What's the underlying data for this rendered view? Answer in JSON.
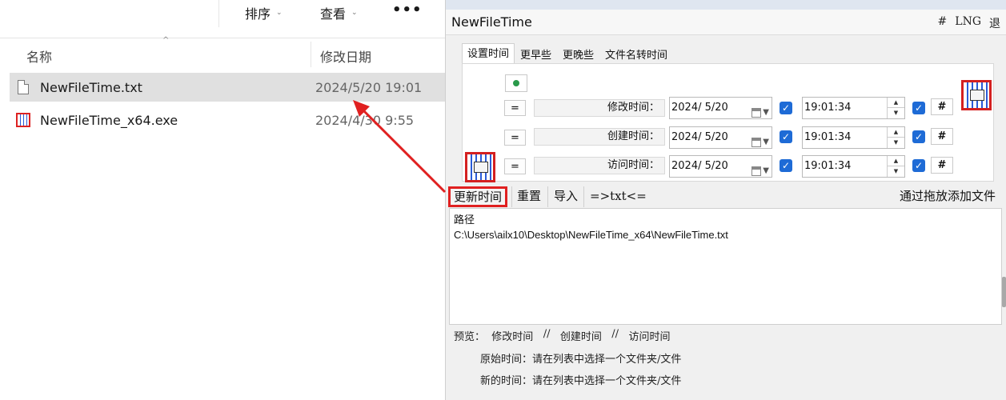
{
  "explorer": {
    "toolbar": {
      "sort_label": "排序",
      "view_label": "查看",
      "more_label": "•••"
    },
    "columns": {
      "name": "名称",
      "modified": "修改日期"
    },
    "files": [
      {
        "name": "NewFileTime.txt",
        "modified": "2024/5/20 19:01",
        "icon": "text-file-icon",
        "selected": true
      },
      {
        "name": "NewFileTime_x64.exe",
        "modified": "2024/4/30 9:55",
        "icon": "app-exe-icon",
        "selected": false
      }
    ]
  },
  "newfiletime": {
    "title": "NewFileTime",
    "title_actions": {
      "hash": "#",
      "lang": "LNG",
      "exit": "退"
    },
    "tabs": [
      "设置时间",
      "更早些",
      "更晚些",
      "文件名转时间"
    ],
    "active_tab": 0,
    "rows": [
      {
        "eq": "=",
        "label": "修改时间：",
        "date": "2024/  5/20",
        "time": "19:01:34",
        "hash": "#"
      },
      {
        "eq": "=",
        "label": "创建时间：",
        "date": "2024/  5/20",
        "time": "19:01:34",
        "hash": "#"
      },
      {
        "eq": "=",
        "label": "访问时间：",
        "date": "2024/  5/20",
        "time": "19:01:34",
        "hash": "#"
      }
    ],
    "actions": {
      "update": "更新时间",
      "reset": "重置",
      "import": "导入",
      "txt": "=>txt<=",
      "drop_hint": "通过拖放添加文件"
    },
    "list": {
      "header": "路径",
      "items": [
        "C:\\Users\\ailx10\\Desktop\\NewFileTime_x64\\NewFileTime.txt"
      ]
    },
    "preview": {
      "label": "预览：",
      "modified": "修改时间",
      "sep": "//",
      "created": "创建时间",
      "accessed": "访问时间",
      "original": "原始时间：请在列表中选择一个文件夹/文件",
      "new": "新的时间：请在列表中选择一个文件夹/文件"
    }
  },
  "colors": {
    "highlight_red": "#e02020",
    "check_blue": "#1e6bd6",
    "selection_gray": "#e0e0e0"
  }
}
